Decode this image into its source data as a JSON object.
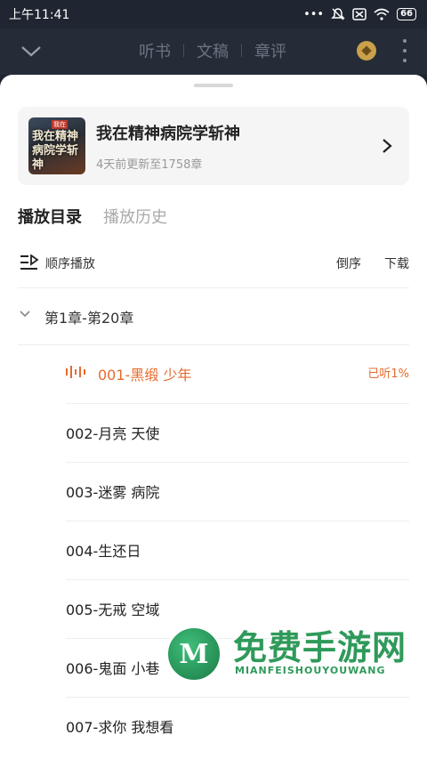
{
  "status_bar": {
    "time": "上午11:41",
    "battery": "66"
  },
  "top_nav": {
    "tabs": [
      "听书",
      "文稿",
      "章评"
    ]
  },
  "book": {
    "title": "我在精神病院学斩神",
    "subtitle": "4天前更新至1758章",
    "cover_text": "我在精神病院学斩神"
  },
  "tabs": {
    "catalog": "播放目录",
    "history": "播放历史"
  },
  "controls": {
    "order": "顺序播放",
    "reverse": "倒序",
    "download": "下载"
  },
  "group": {
    "label": "第1章-第20章"
  },
  "chapters": [
    {
      "label": "001-黑缎 少年",
      "progress": "已听1%"
    },
    {
      "label": "002-月亮 天使"
    },
    {
      "label": "003-迷雾 病院"
    },
    {
      "label": "004-生还日"
    },
    {
      "label": "005-无戒 空域"
    },
    {
      "label": "006-鬼面 小巷"
    },
    {
      "label": "007-求你 我想看"
    }
  ],
  "watermark": {
    "title": "免费手游网",
    "subtitle": "MIANFEISHOUYOUWANG"
  },
  "colors": {
    "accent": "#e66a2c",
    "nav_bg": "#252c38",
    "watermark": "#2f9a5a"
  }
}
